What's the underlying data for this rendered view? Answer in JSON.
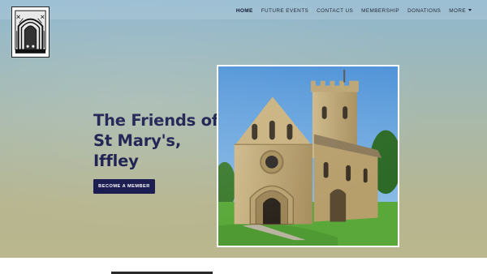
{
  "nav": {
    "items": [
      "HOME",
      "FUTURE EVENTS",
      "CONTACT US",
      "MEMBERSHIP",
      "DONATIONS"
    ],
    "more_label": "MORE",
    "active_item": "HOME"
  },
  "hero": {
    "title": "The Friends of St Mary's, Iffley",
    "cta_label": "BECOME A MEMBER"
  },
  "colors": {
    "accent": "#14154a",
    "title": "#14174a",
    "nav_text": "#1f2a3a"
  },
  "icons": {
    "logo": "church-doorway-icon",
    "more": "caret-down-icon"
  }
}
